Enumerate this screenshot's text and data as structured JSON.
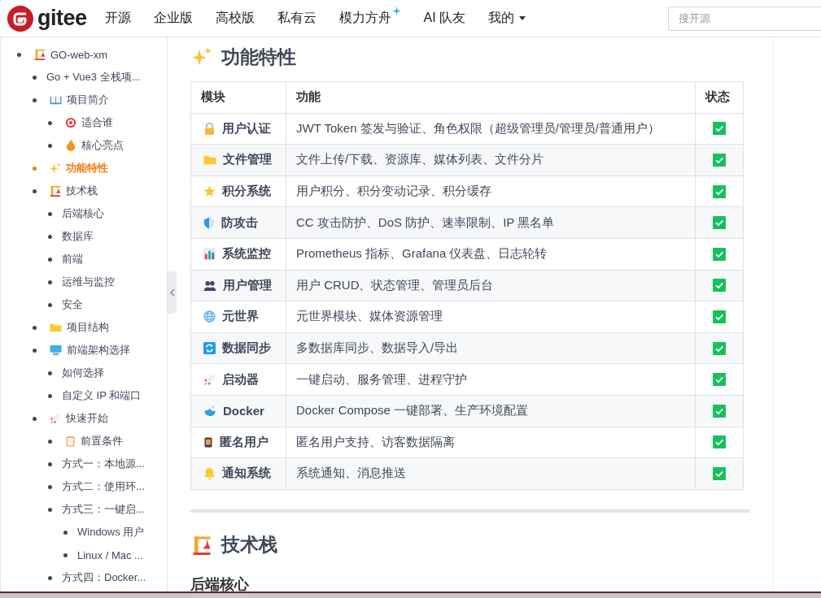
{
  "header": {
    "logo_text": "gitee",
    "nav": [
      {
        "label": "开源",
        "kind": "plain"
      },
      {
        "label": "企业版",
        "kind": "plain"
      },
      {
        "label": "高校版",
        "kind": "plain"
      },
      {
        "label": "私有云",
        "kind": "plain"
      },
      {
        "label": "模力方舟",
        "kind": "sparkle"
      },
      {
        "label": "AI 队友",
        "kind": "plain"
      },
      {
        "label": "我的",
        "kind": "dropdown"
      }
    ],
    "search": {
      "placeholder": "搜开源"
    }
  },
  "sidebar": {
    "items": [
      {
        "label": "GO-web-xm",
        "selected": false,
        "children": [
          {
            "label": "Go + Vue3 全栈项...",
            "selected": false
          },
          {
            "label": "项目简介",
            "selected": false,
            "children": [
              {
                "label": "适合谁",
                "selected": false
              },
              {
                "label": "核心亮点",
                "selected": false
              }
            ]
          },
          {
            "label": "功能特性",
            "selected": true
          },
          {
            "label": "技术栈",
            "selected": false,
            "children": [
              {
                "label": "后端核心",
                "selected": false
              },
              {
                "label": "数据库",
                "selected": false
              },
              {
                "label": "前端",
                "selected": false
              },
              {
                "label": "运维与监控",
                "selected": false
              },
              {
                "label": "安全",
                "selected": false
              }
            ]
          },
          {
            "label": "项目结构",
            "selected": false
          },
          {
            "label": "前端架构选择",
            "selected": false,
            "children": [
              {
                "label": "如何选择",
                "selected": false
              },
              {
                "label": "自定义 IP 和端口",
                "selected": false
              }
            ]
          },
          {
            "label": "快速开始",
            "selected": false,
            "children": [
              {
                "label": "前置条件",
                "selected": false
              },
              {
                "label": "方式一：本地源...",
                "selected": false
              },
              {
                "label": "方式二：使用环...",
                "selected": false
              },
              {
                "label": "方式三：一键启...",
                "selected": false,
                "children": [
                  {
                    "label": "Windows 用户",
                    "selected": false
                  },
                  {
                    "label": "Linux / Mac ...",
                    "selected": false
                  }
                ]
              },
              {
                "label": "方式四：Docker...",
                "selected": false
              }
            ]
          }
        ]
      }
    ]
  },
  "content": {
    "section_title": "功能特性",
    "table": {
      "columns": [
        "模块",
        "功能",
        "状态"
      ],
      "rows": [
        {
          "module": "用户认证",
          "feature": "JWT Token 签发与验证、角色权限（超级管理员/管理员/普通用户）",
          "done": true
        },
        {
          "module": "文件管理",
          "feature": "文件上传/下载、资源库、媒体列表、文件分片",
          "done": true
        },
        {
          "module": "积分系统",
          "feature": "用户积分、积分变动记录、积分缓存",
          "done": true
        },
        {
          "module": "防攻击",
          "feature": "CC 攻击防护、DoS 防护、速率限制、IP 黑名单",
          "done": true
        },
        {
          "module": "系统监控",
          "feature": "Prometheus 指标、Grafana 仪表盘、日志轮转",
          "done": true
        },
        {
          "module": "用户管理",
          "feature": "用户 CRUD、状态管理、管理员后台",
          "done": true
        },
        {
          "module": "元世界",
          "feature": "元世界模块、媒体资源管理",
          "done": true
        },
        {
          "module": "数据同步",
          "feature": "多数据库同步、数据导入/导出",
          "done": true
        },
        {
          "module": "启动器",
          "feature": "一键启动、服务管理、进程守护",
          "done": true
        },
        {
          "module": "Docker",
          "feature": "Docker Compose 一键部署、生产环境配置",
          "done": true
        },
        {
          "module": "匿名用户",
          "feature": "匿名用户支持、访客数据隔离",
          "done": true
        },
        {
          "module": "通知系统",
          "feature": "系统通知、消息推送",
          "done": true
        }
      ]
    },
    "next_title": "技术栈",
    "subheading": "后端核心"
  }
}
